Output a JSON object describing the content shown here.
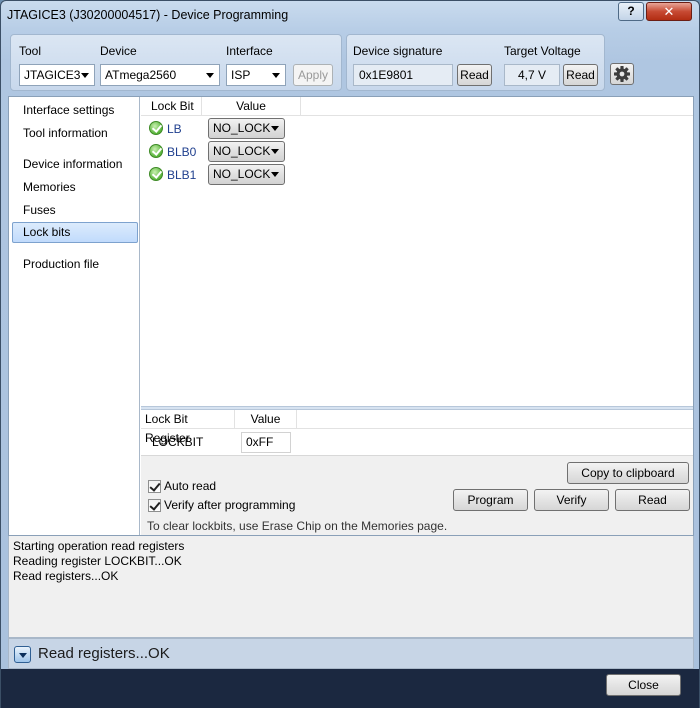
{
  "window": {
    "title": "JTAGICE3 (J30200004517) - Device Programming",
    "help_label": "?",
    "close_glyph": "✕"
  },
  "tool_group": {
    "tool_label": "Tool",
    "tool_value": "JTAGICE3",
    "device_label": "Device",
    "device_value": "ATmega2560",
    "interface_label": "Interface",
    "interface_value": "ISP",
    "apply_label": "Apply"
  },
  "signature_group": {
    "signature_label": "Device signature",
    "signature_value": "0x1E9801",
    "signature_read_label": "Read",
    "voltage_label": "Target Voltage",
    "voltage_value": "4,7 V",
    "voltage_read_label": "Read"
  },
  "nav": {
    "items": [
      {
        "label": "Interface settings"
      },
      {
        "label": "Tool information"
      },
      {
        "label": "Device information"
      },
      {
        "label": "Memories"
      },
      {
        "label": "Fuses"
      },
      {
        "label": "Lock bits"
      },
      {
        "label": "Production file"
      }
    ],
    "selected": "Lock bits"
  },
  "lockbits": {
    "col_name": "Lock Bit",
    "col_value": "Value",
    "rows": [
      {
        "name": "LB",
        "value": "NO_LOCK"
      },
      {
        "name": "BLB0",
        "value": "NO_LOCK"
      },
      {
        "name": "BLB1",
        "value": "NO_LOCK"
      }
    ]
  },
  "register": {
    "col_name": "Lock Bit Register",
    "col_value": "Value",
    "name": "LOCKBIT",
    "value": "0xFF"
  },
  "options": {
    "auto_read_label": "Auto read",
    "verify_label": "Verify after programming",
    "copy_label": "Copy to clipboard",
    "program_label": "Program",
    "verify_button_label": "Verify",
    "read_label": "Read",
    "hint": "To clear lockbits, use Erase Chip on the Memories page."
  },
  "log": {
    "lines": [
      "Starting operation read registers",
      "Reading register LOCKBIT...OK",
      "Read registers...OK"
    ]
  },
  "status": {
    "text": "Read registers...OK"
  },
  "footer": {
    "close_label": "Close"
  }
}
